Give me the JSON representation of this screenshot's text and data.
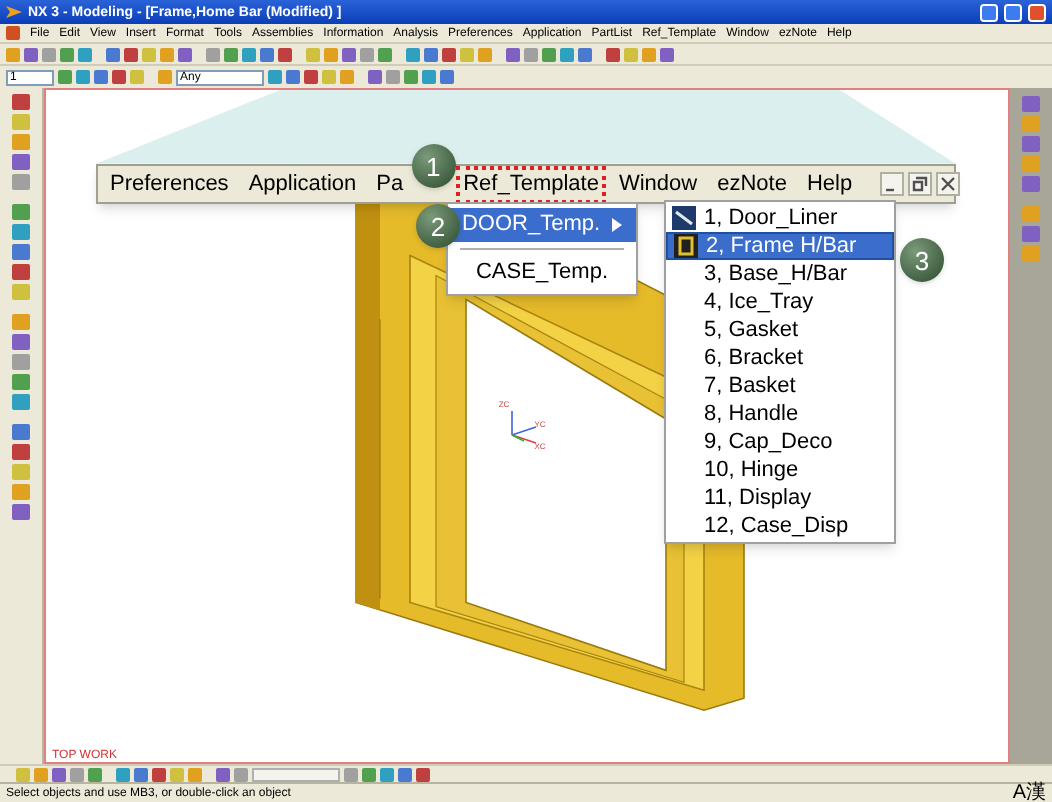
{
  "window": {
    "title": "NX 3 - Modeling - [Frame,Home Bar (Modified) ]"
  },
  "menu_bar": [
    "File",
    "Edit",
    "View",
    "Insert",
    "Format",
    "Tools",
    "Assemblies",
    "Information",
    "Analysis",
    "Preferences",
    "Application",
    "PartList",
    "Ref_Template",
    "Window",
    "ezNote",
    "Help"
  ],
  "toolbar": {
    "layer": "1",
    "snap_filter": "Any"
  },
  "zoomed_menu": [
    {
      "label": "Preferences",
      "selected": false
    },
    {
      "label": "Application",
      "selected": false
    },
    {
      "label": "Pa",
      "selected": false
    },
    {
      "label": "Ref_Template",
      "selected": true
    },
    {
      "label": "Window",
      "selected": false
    },
    {
      "label": "ezNote",
      "selected": false
    },
    {
      "label": "Help",
      "selected": false
    }
  ],
  "ref_template_menu": [
    {
      "label": "DOOR_Temp.",
      "selected": true,
      "has_submenu": true
    },
    {
      "label": "CASE_Temp.",
      "selected": false,
      "has_submenu": false
    }
  ],
  "door_template_menu": [
    {
      "label": "1, Door_Liner",
      "selected": false,
      "icon": true
    },
    {
      "label": "2, Frame H/Bar",
      "selected": true,
      "icon": true
    },
    {
      "label": "3, Base_H/Bar",
      "selected": false,
      "icon": false
    },
    {
      "label": "4, Ice_Tray",
      "selected": false,
      "icon": false
    },
    {
      "label": "5, Gasket",
      "selected": false,
      "icon": false
    },
    {
      "label": "6, Bracket",
      "selected": false,
      "icon": false
    },
    {
      "label": "7, Basket",
      "selected": false,
      "icon": false
    },
    {
      "label": "8, Handle",
      "selected": false,
      "icon": false
    },
    {
      "label": "9, Cap_Deco",
      "selected": false,
      "icon": false
    },
    {
      "label": "10, Hinge",
      "selected": false,
      "icon": false
    },
    {
      "label": "11, Display",
      "selected": false,
      "icon": false
    },
    {
      "label": "12, Case_Disp",
      "selected": false,
      "icon": false
    }
  ],
  "callouts": [
    "1",
    "2",
    "3"
  ],
  "axes": [
    "ZC",
    "YC",
    "XC"
  ],
  "view_label": "TOP WORK",
  "status_bar": {
    "message": "Select objects and use MB3, or double-click an object",
    "ime": "A漢"
  }
}
